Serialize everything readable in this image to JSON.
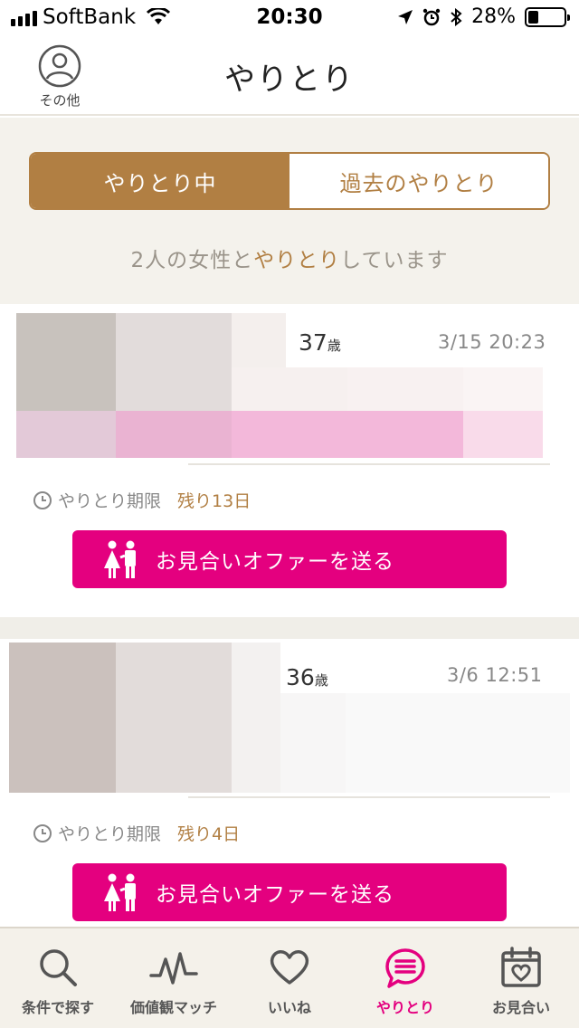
{
  "status_bar": {
    "carrier": "SoftBank",
    "time": "20:30",
    "battery": "28%",
    "battery_level": 0.28
  },
  "header": {
    "title": "やりとり",
    "other_label": "その他"
  },
  "tabs": {
    "active_label": "やりとり中",
    "inactive_label": "過去のやりとり"
  },
  "summary": {
    "prefix": "2人の女性と",
    "highlight": "やりとり",
    "suffix": "しています"
  },
  "cards": [
    {
      "age_number": "37",
      "age_unit": "歳",
      "date": "3/15 20:23",
      "deadline_label": "やりとり期限",
      "remaining": "残り13日",
      "offer_label": "お見合いオファーを送る"
    },
    {
      "age_number": "36",
      "age_unit": "歳",
      "date": "3/6 12:51",
      "deadline_label": "やりとり期限",
      "remaining": "残り4日",
      "offer_label": "お見合いオファーを送る"
    }
  ],
  "tab_bar": {
    "items": [
      {
        "label": "条件で探す",
        "icon": "search-icon",
        "active": false
      },
      {
        "label": "価値観マッチ",
        "icon": "pulse-icon",
        "active": false
      },
      {
        "label": "いいね",
        "icon": "heart-icon",
        "active": false
      },
      {
        "label": "やりとり",
        "icon": "chat-icon",
        "active": true
      },
      {
        "label": "お見合い",
        "icon": "calendar-heart-icon",
        "active": false
      }
    ]
  },
  "colors": {
    "brand_gold": "#b17f43",
    "accent_pink": "#e4007f",
    "background_beige": "#f4f2ec"
  }
}
